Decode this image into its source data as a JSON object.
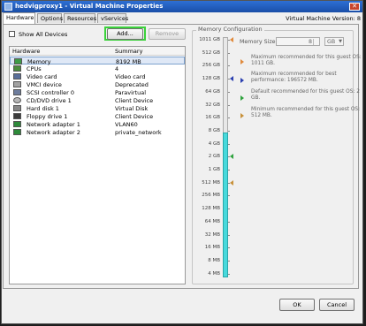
{
  "window": {
    "title": "hedvigproxy1 - Virtual Machine Properties",
    "close_label": "✕"
  },
  "tabs": [
    "Hardware",
    "Options",
    "Resources",
    "vServices"
  ],
  "version_label": "Virtual Machine Version: 8",
  "show_all_devices": {
    "label": "Show All Devices",
    "checked": false
  },
  "buttons": {
    "add": "Add...",
    "remove": "Remove",
    "ok": "OK",
    "cancel": "Cancel"
  },
  "hardware_table": {
    "columns": [
      "Hardware",
      "Summary"
    ],
    "rows": [
      {
        "name": "Memory",
        "summary": "8192 MB",
        "icon": "memory-icon",
        "selected": true
      },
      {
        "name": "CPUs",
        "summary": "4",
        "icon": "cpu-icon"
      },
      {
        "name": "Video card",
        "summary": "Video card",
        "icon": "video-card-icon"
      },
      {
        "name": "VMCI device",
        "summary": "Deprecated",
        "icon": "vmci-icon"
      },
      {
        "name": "SCSI controller 0",
        "summary": "Paravirtual",
        "icon": "scsi-icon"
      },
      {
        "name": "CD/DVD drive 1",
        "summary": "Client Device",
        "icon": "cdrom-icon"
      },
      {
        "name": "Hard disk 1",
        "summary": "Virtual Disk",
        "icon": "disk-icon"
      },
      {
        "name": "Floppy drive 1",
        "summary": "Client Device",
        "icon": "floppy-icon"
      },
      {
        "name": "Network adapter 1",
        "summary": "VLAN60",
        "icon": "network-icon"
      },
      {
        "name": "Network adapter 2",
        "summary": "private_network",
        "icon": "network-icon"
      }
    ]
  },
  "memory_config": {
    "group_label": "Memory Configuration",
    "size_label": "Memory Size:",
    "size_value": "8",
    "unit": "GB",
    "scale": [
      "1011 GB",
      "512 GB",
      "256 GB",
      "128 GB",
      "64 GB",
      "32 GB",
      "16 GB",
      "8 GB",
      "4 GB",
      "2 GB",
      "1 GB",
      "512 MB",
      "256 MB",
      "128 MB",
      "64 MB",
      "32 MB",
      "16 MB",
      "8 MB",
      "4 MB"
    ],
    "legend": [
      {
        "text": "Maximum recommended for this guest OS: 1011 GB.",
        "color": "#e08a3c"
      },
      {
        "text": "Maximum recommended for best performance: 196572 MB.",
        "color": "#2a3fb0"
      },
      {
        "text": "Default recommended for this guest OS: 2 GB.",
        "color": "#2fa33f"
      },
      {
        "text": "Minimum recommended for this guest OS: 512 MB.",
        "color": "#c8913a"
      }
    ]
  }
}
